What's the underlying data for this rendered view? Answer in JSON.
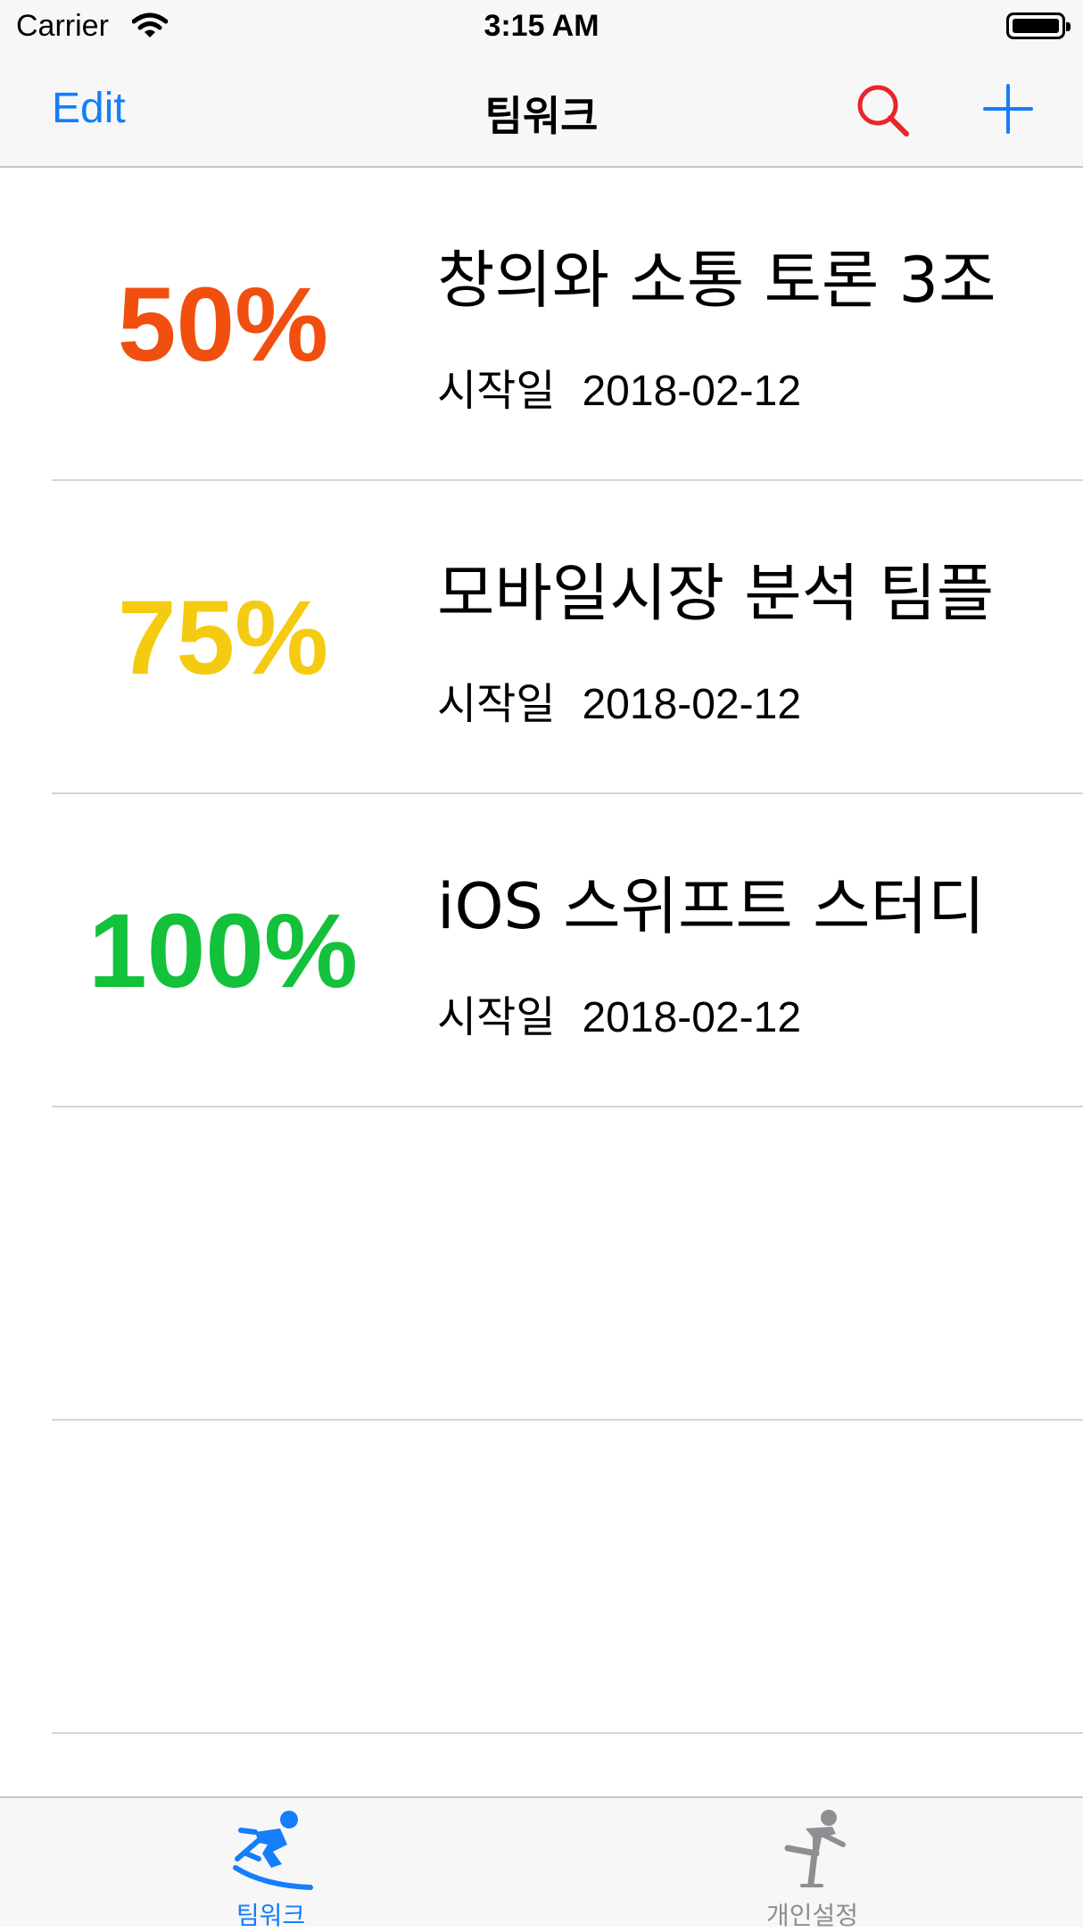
{
  "status_bar": {
    "carrier": "Carrier",
    "time": "3:15 AM"
  },
  "nav": {
    "edit_label": "Edit",
    "title": "팀워크",
    "search_icon": "search-icon",
    "add_icon": "plus-icon"
  },
  "colors": {
    "accent": "#147efb",
    "search": "#e8262b",
    "tab_inactive": "#8e8e93"
  },
  "rows": [
    {
      "percent": "50%",
      "percent_color": "#f04f0f",
      "title": "창의와 소통 토론 3조",
      "start_label": "시작일",
      "start_date": "2018-02-12"
    },
    {
      "percent": "75%",
      "percent_color": "#f5cb12",
      "title": "모바일시장 분석 팀플",
      "start_label": "시작일",
      "start_date": "2018-02-12"
    },
    {
      "percent": "100%",
      "percent_color": "#13c13a",
      "title": "iOS 스위프트 스터디",
      "start_label": "시작일",
      "start_date": "2018-02-12"
    }
  ],
  "tabs": [
    {
      "label": "팀워크",
      "icon": "skier-icon",
      "selected": true
    },
    {
      "label": "개인설정",
      "icon": "skater-icon",
      "selected": false
    }
  ]
}
